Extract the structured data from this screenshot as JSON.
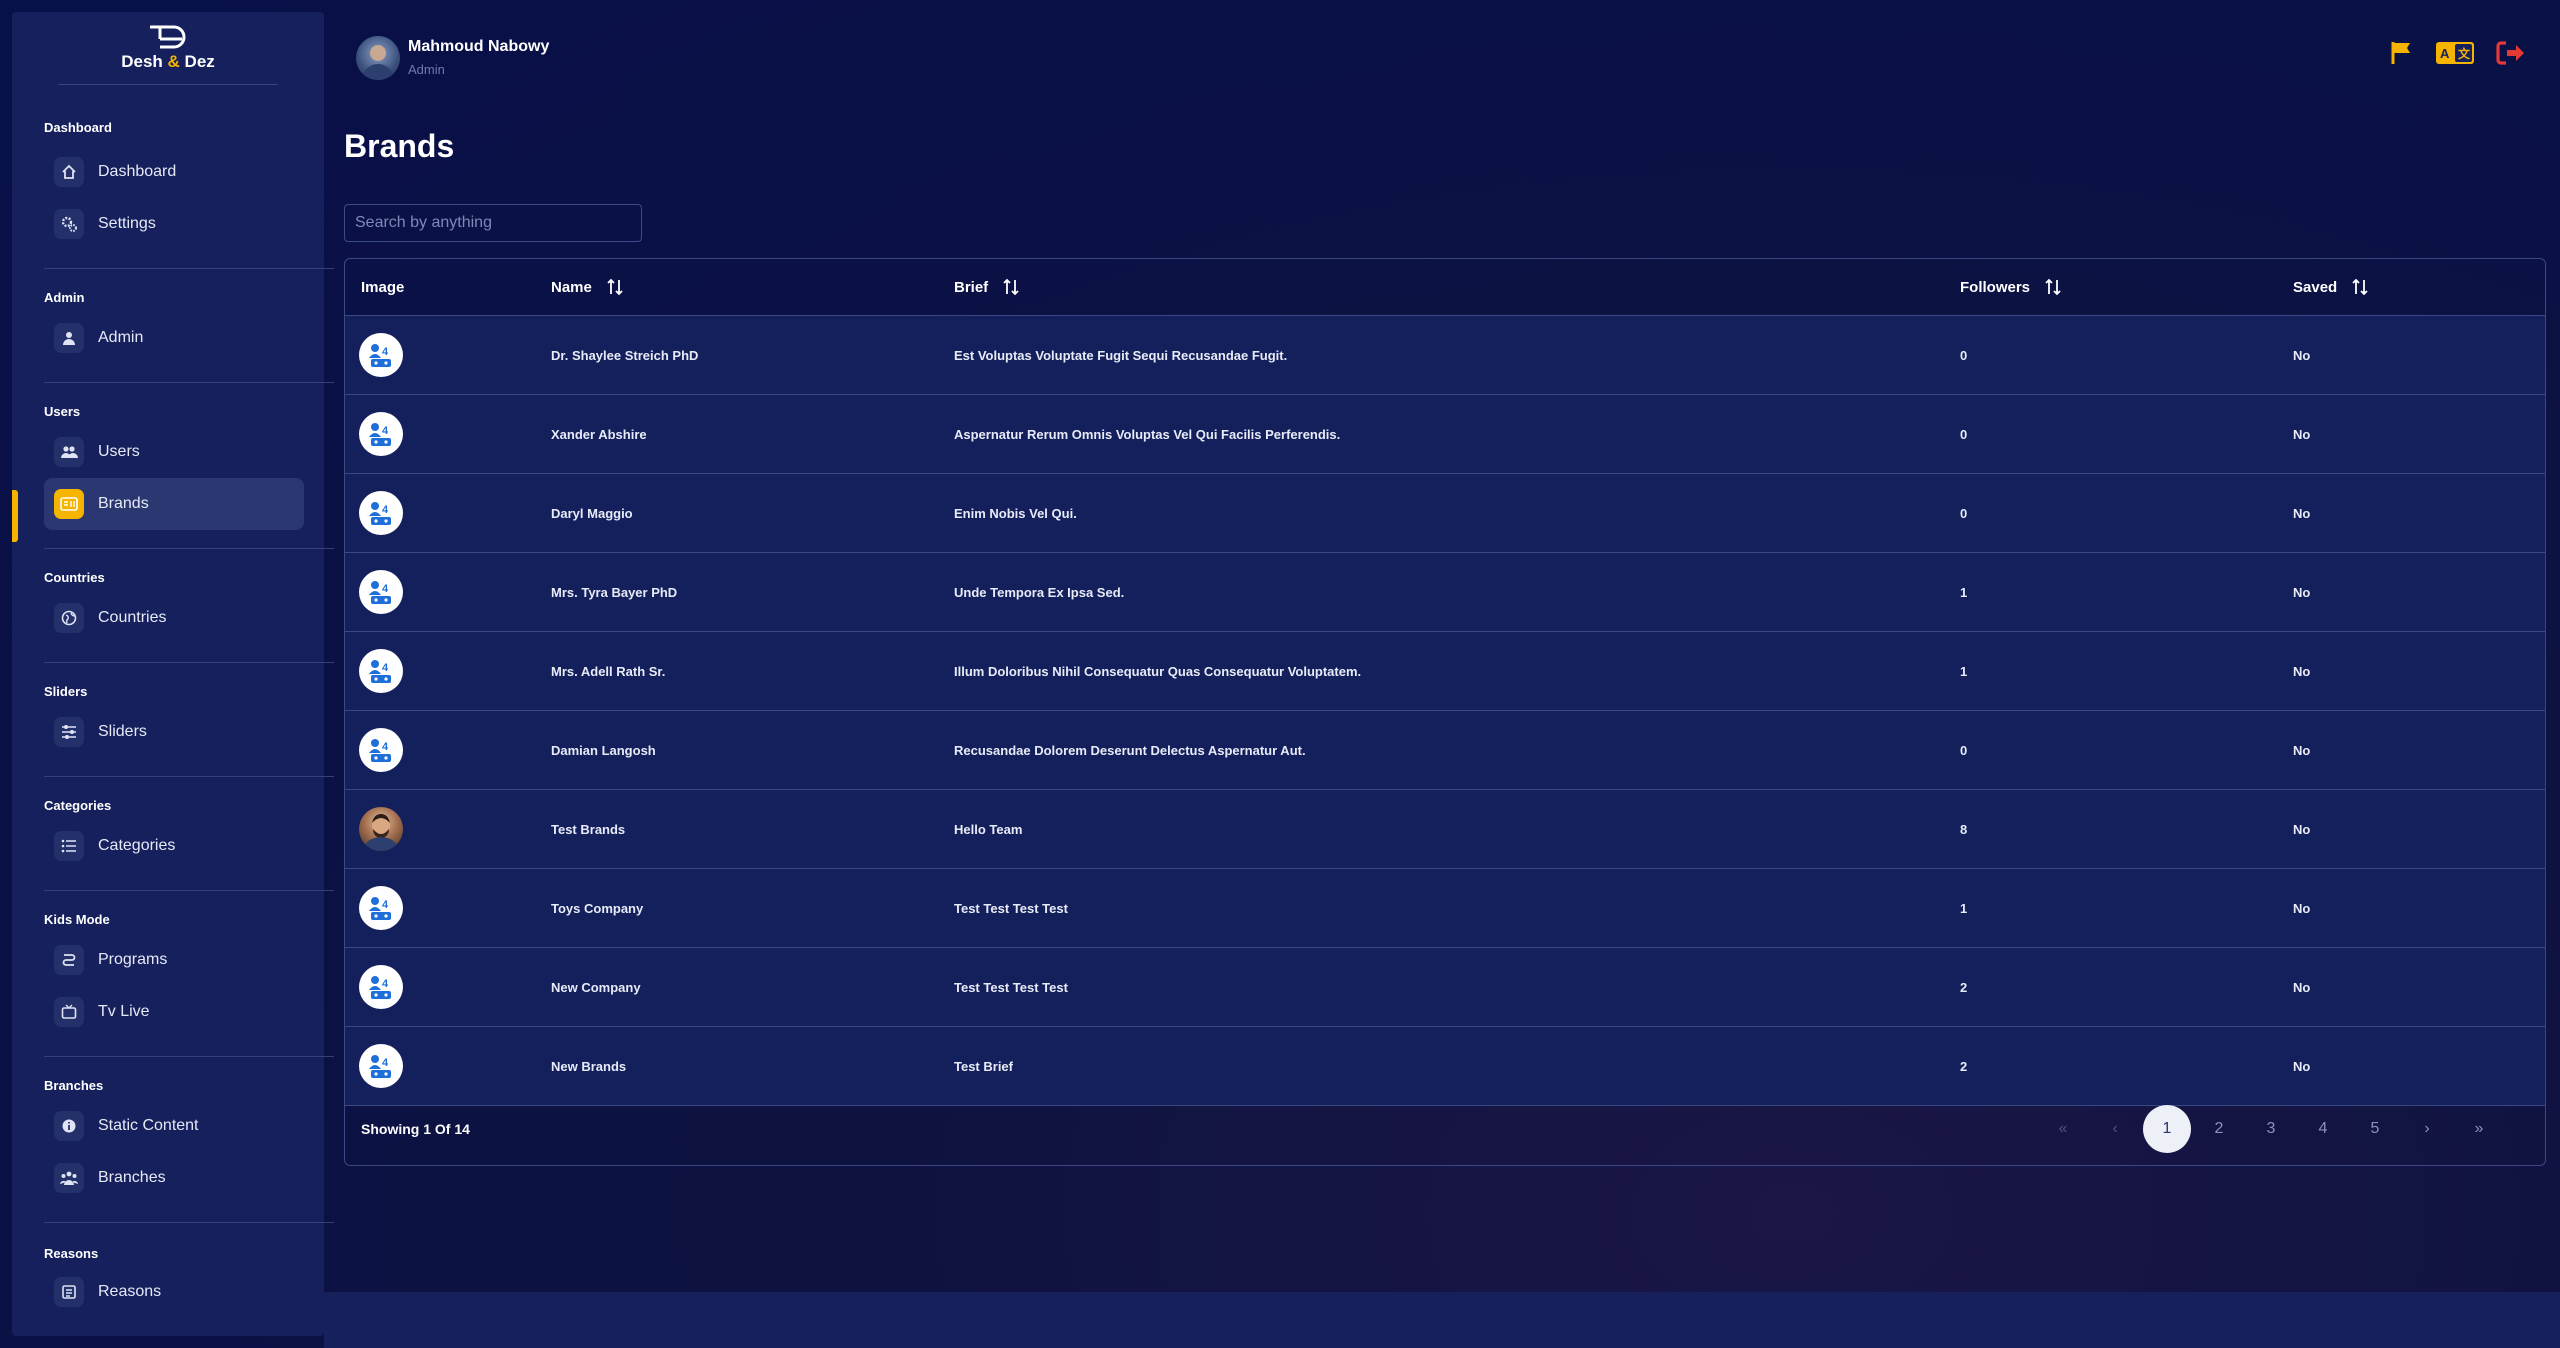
{
  "app": {
    "name_part1": "Desh",
    "name_amp": "&",
    "name_part2": "Dez"
  },
  "user": {
    "name": "Mahmoud Nabowy",
    "role": "Admin"
  },
  "header_icons": [
    "flag-icon",
    "translate-icon",
    "logout-icon"
  ],
  "colors": {
    "accent": "#f5b400",
    "logout": "#e53935",
    "sidebar": "#15205c"
  },
  "sidebar": {
    "sections": [
      {
        "title": "Dashboard",
        "items": [
          {
            "label": "Dashboard",
            "icon": "home-icon"
          },
          {
            "label": "Settings",
            "icon": "gears-icon"
          }
        ]
      },
      {
        "title": "Admin",
        "items": [
          {
            "label": "Admin",
            "icon": "user-icon"
          }
        ]
      },
      {
        "title": "Users",
        "items": [
          {
            "label": "Users",
            "icon": "users-icon"
          },
          {
            "label": "Brands",
            "icon": "brands-icon",
            "active": true
          }
        ]
      },
      {
        "title": "Countries",
        "items": [
          {
            "label": "Countries",
            "icon": "globe-icon"
          }
        ]
      },
      {
        "title": "Sliders",
        "items": [
          {
            "label": "Sliders",
            "icon": "sliders-icon"
          }
        ]
      },
      {
        "title": "Categories",
        "items": [
          {
            "label": "Categories",
            "icon": "list-icon"
          }
        ]
      },
      {
        "title": "Kids Mode",
        "items": [
          {
            "label": "Programs",
            "icon": "route-icon"
          },
          {
            "label": "Tv Live",
            "icon": "tv-icon"
          }
        ]
      },
      {
        "title": "Branches",
        "items": [
          {
            "label": "Static Content",
            "icon": "info-icon"
          },
          {
            "label": "Branches",
            "icon": "group-icon"
          }
        ]
      },
      {
        "title": "Reasons",
        "items": [
          {
            "label": "Reasons",
            "icon": "reasons-icon"
          }
        ]
      }
    ]
  },
  "page": {
    "title": "Brands"
  },
  "search": {
    "placeholder": "Search by anything",
    "value": ""
  },
  "table": {
    "headers": {
      "image": "Image",
      "name": "Name",
      "brief": "Brief",
      "followers": "Followers",
      "saved": "Saved"
    },
    "rows": [
      {
        "image": "logo",
        "name": "Dr. Shaylee Streich PhD",
        "brief": "Est Voluptas Voluptate Fugit Sequi Recusandae Fugit.",
        "followers": "0",
        "saved": "No"
      },
      {
        "image": "logo",
        "name": "Xander Abshire",
        "brief": "Aspernatur Rerum Omnis Voluptas Vel Qui Facilis Perferendis.",
        "followers": "0",
        "saved": "No"
      },
      {
        "image": "logo",
        "name": "Daryl Maggio",
        "brief": "Enim Nobis Vel Qui.",
        "followers": "0",
        "saved": "No"
      },
      {
        "image": "logo",
        "name": "Mrs. Tyra Bayer PhD",
        "brief": "Unde Tempora Ex Ipsa Sed.",
        "followers": "1",
        "saved": "No"
      },
      {
        "image": "logo",
        "name": "Mrs. Adell Rath Sr.",
        "brief": "Illum Doloribus Nihil Consequatur Quas Consequatur Voluptatem.",
        "followers": "1",
        "saved": "No"
      },
      {
        "image": "logo",
        "name": "Damian Langosh",
        "brief": "Recusandae Dolorem Deserunt Delectus Aspernatur Aut.",
        "followers": "0",
        "saved": "No"
      },
      {
        "image": "photo",
        "name": "Test Brands",
        "brief": "Hello Team",
        "followers": "8",
        "saved": "No"
      },
      {
        "image": "logo",
        "name": "Toys Company",
        "brief": "Test Test Test Test",
        "followers": "1",
        "saved": "No"
      },
      {
        "image": "logo",
        "name": "New Company",
        "brief": "Test Test Test Test",
        "followers": "2",
        "saved": "No"
      },
      {
        "image": "logo",
        "name": "New Brands",
        "brief": "Test Brief",
        "followers": "2",
        "saved": "No"
      }
    ]
  },
  "pagination": {
    "showing": "Showing 1 Of 14",
    "first": "«",
    "prev": "‹",
    "next": "›",
    "last": "»",
    "pages": [
      "1",
      "2",
      "3",
      "4",
      "5"
    ],
    "current": "1"
  }
}
